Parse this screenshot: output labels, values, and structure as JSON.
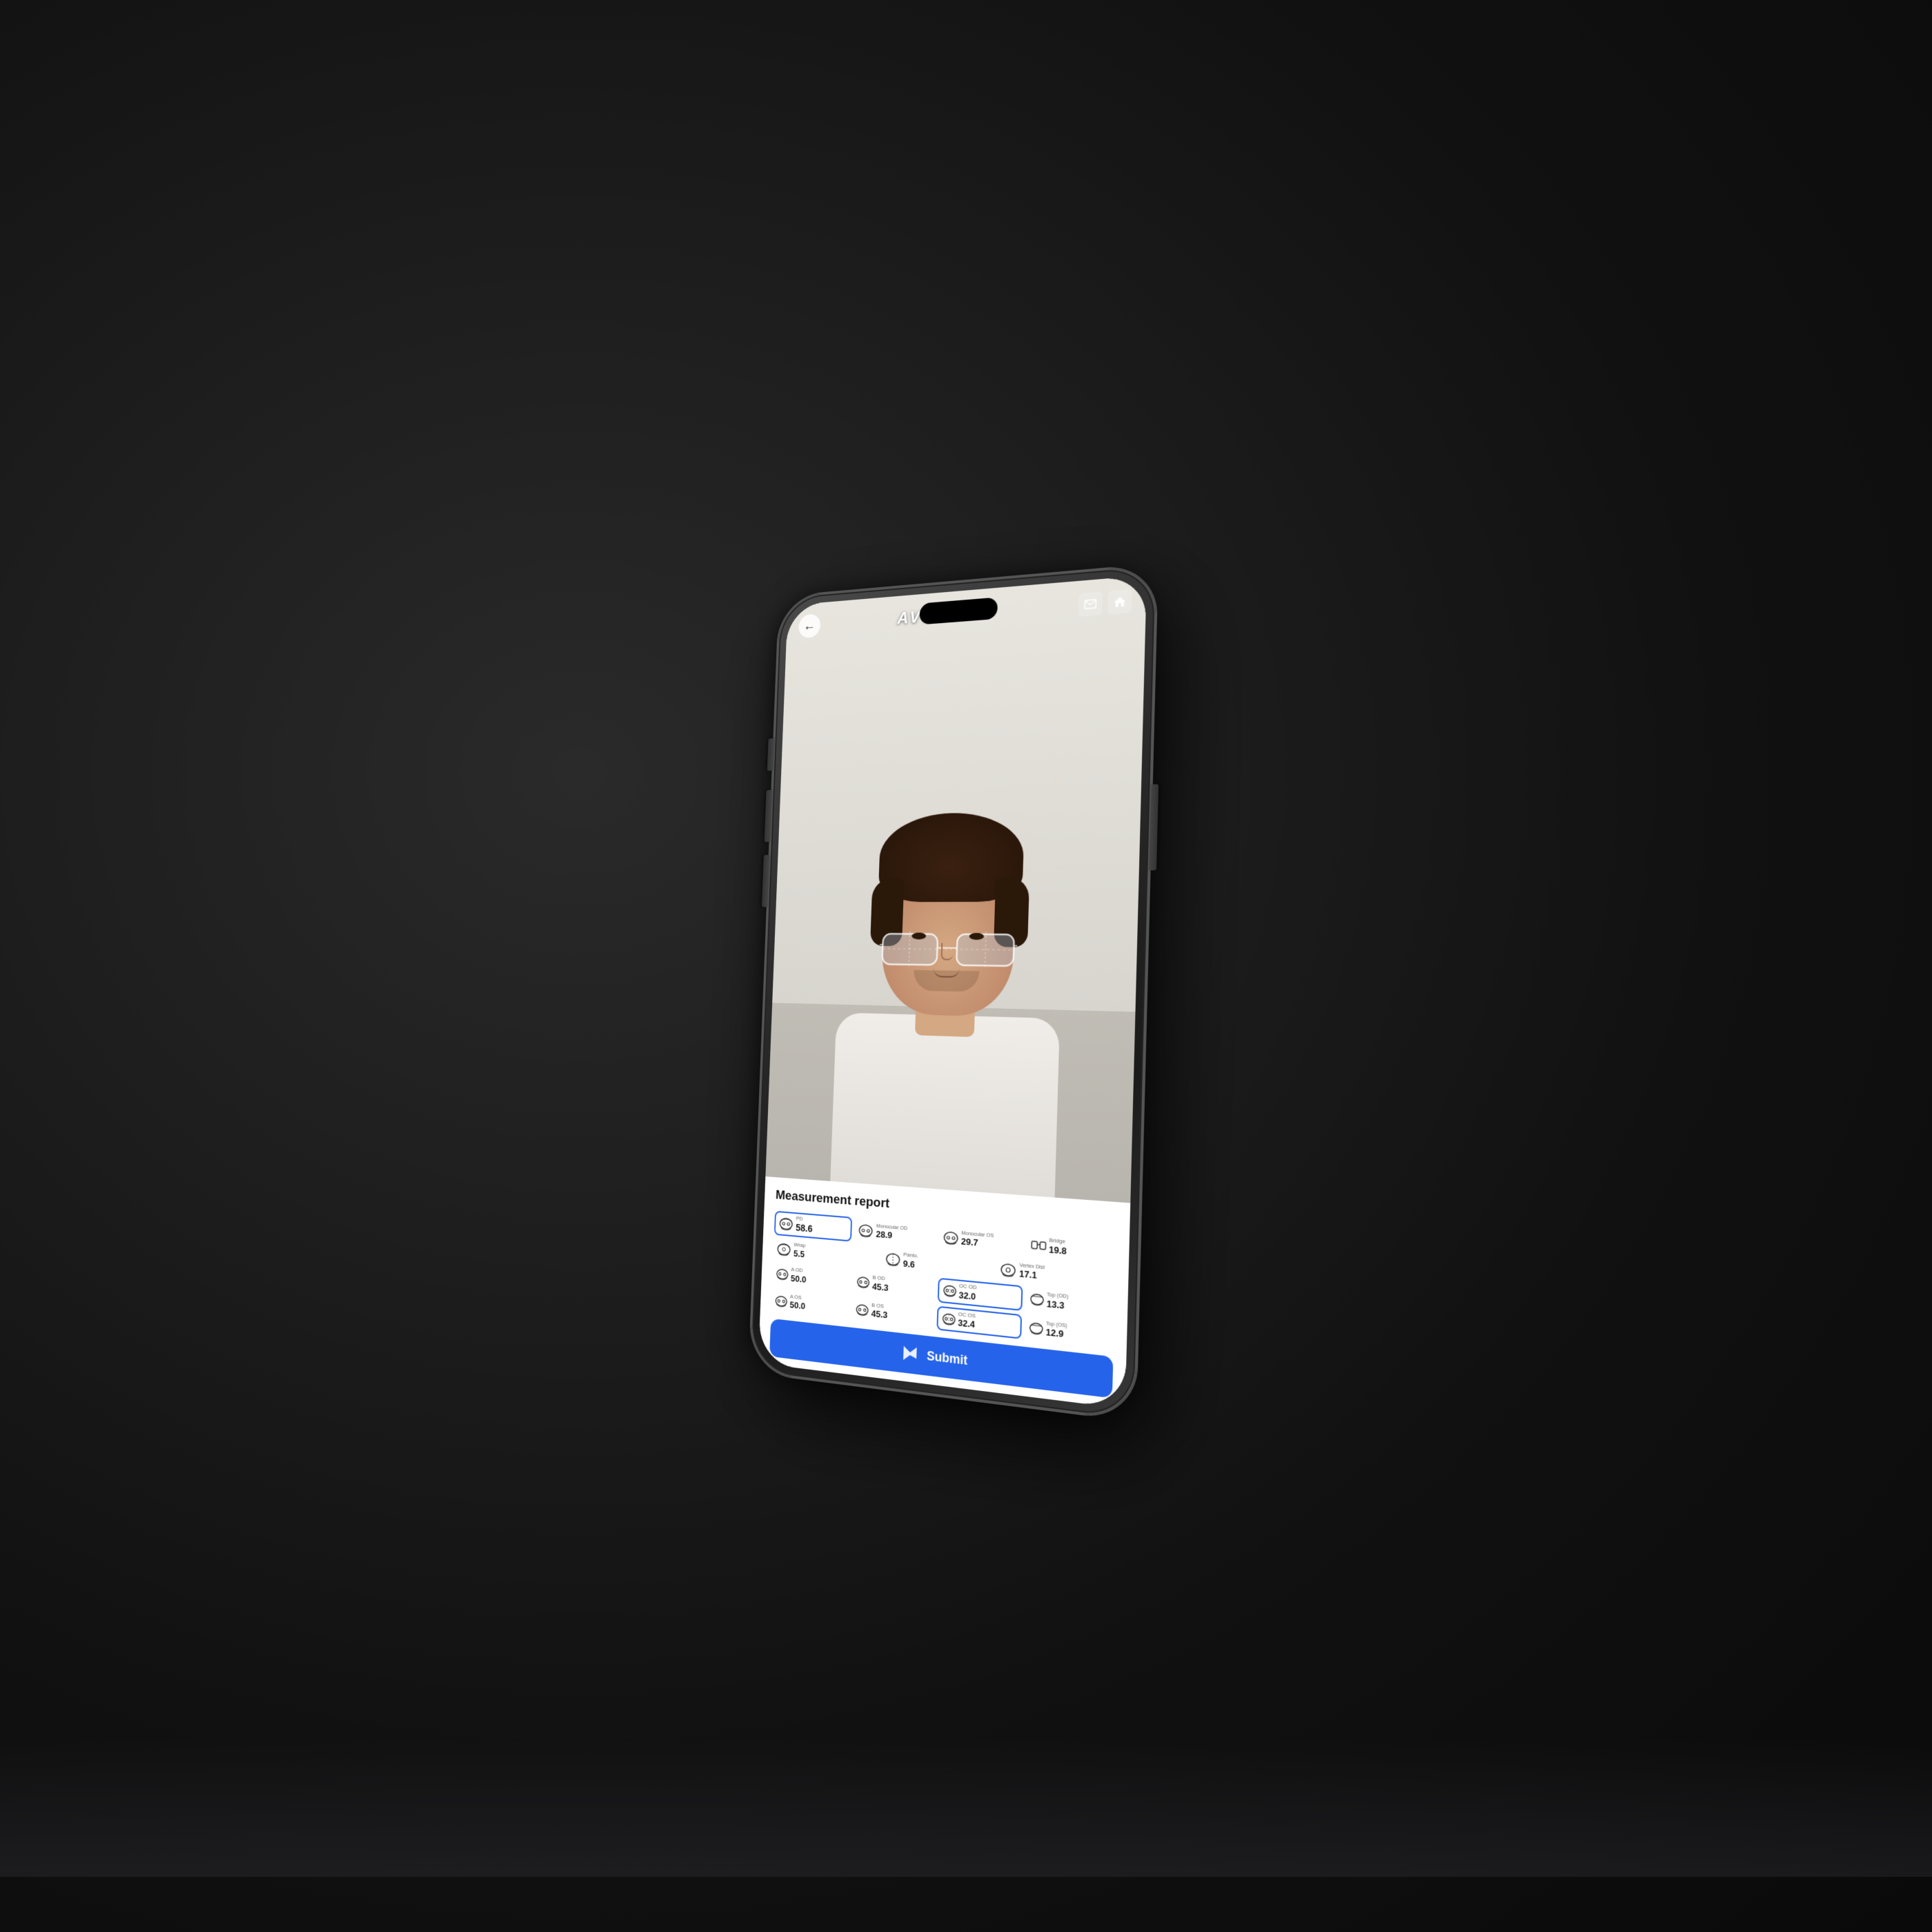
{
  "app": {
    "title": "Avolux",
    "logo": "AVOLUX",
    "back_label": "‹"
  },
  "header": {
    "back_icon": "←",
    "mail_icon": "✉",
    "home_icon": "⌂"
  },
  "report": {
    "title": "Measurement report",
    "measurements": {
      "pd": {
        "label": "PD",
        "value": "58.6",
        "highlighted": true
      },
      "monocular_od": {
        "label": "Monocular OD",
        "value": "28.9"
      },
      "monocular_os": {
        "label": "Monocular OS",
        "value": "29.7"
      },
      "bridge": {
        "label": "Bridge",
        "value": "19.8"
      },
      "wrap": {
        "label": "Wrap",
        "value": "5.5"
      },
      "panto": {
        "label": "Panto.",
        "value": "9.6"
      },
      "vertex_dist": {
        "label": "Vertex Dist",
        "value": "17.1"
      },
      "a_od": {
        "label": "A OD",
        "value": "50.0"
      },
      "b_od": {
        "label": "B OD",
        "value": "45.3"
      },
      "oc_od": {
        "label": "OC OD",
        "value": "32.0",
        "highlighted": true
      },
      "top_od": {
        "label": "Top (OD)",
        "value": "13.3"
      },
      "a_os": {
        "label": "A OS",
        "value": "50.0"
      },
      "b_os": {
        "label": "B OS",
        "value": "45.3"
      },
      "oc_os": {
        "label": "OC OS",
        "value": "32.4",
        "highlighted": true
      },
      "top_os": {
        "label": "Top (OS)",
        "value": "12.9"
      }
    }
  },
  "submit": {
    "label": "Submit",
    "icon": "➤"
  }
}
